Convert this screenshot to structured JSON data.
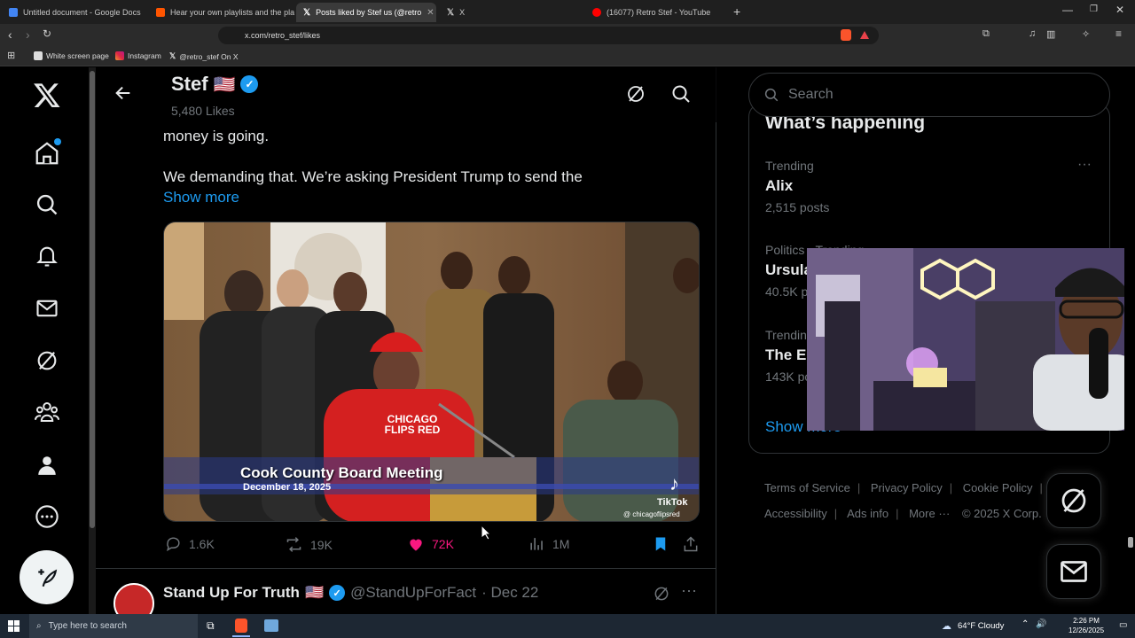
{
  "browser": {
    "tabs": [
      {
        "title": "Untitled document - Google Docs",
        "color": "#4285f4"
      },
      {
        "title": "Hear your own playlists and the play",
        "color": "#ff5500"
      },
      {
        "title": "Posts liked by Stef us (@retro",
        "color": "#ffffff",
        "active": true
      },
      {
        "title": "X",
        "color": "#ffffff"
      },
      {
        "title": "(16077) Retro Stef - YouTube",
        "color": "#ff0000"
      }
    ],
    "url": "x.com/retro_stef/likes",
    "bookmarks": [
      "White screen page",
      "Instagram",
      "@retro_stef On X"
    ]
  },
  "profile_header": {
    "name": "Stef",
    "flag": "🇺🇸",
    "likes_count": "5,480 Likes"
  },
  "tweet": {
    "text_line1": "money is going.",
    "text_line2": "We demanding that. We’re asking President Trump to send the",
    "show_more": "Show more",
    "video": {
      "banner_title": "Cook County Board Meeting",
      "banner_date": "December 18, 2025",
      "hoodie_text": "CHICAGO FLIPS RED",
      "watermark_app": "TikTok",
      "watermark_handle": "@ chicagoflipsred"
    },
    "actions": {
      "replies": "1.6K",
      "reposts": "19K",
      "likes": "72K",
      "views": "1M"
    }
  },
  "next_tweet": {
    "name": "Stand Up For Truth",
    "flag": "🇺🇸",
    "handle": "@StandUpForFact",
    "date": "· Dec 22"
  },
  "sidebar": {
    "search_placeholder": "Search",
    "section_title": "What’s happening",
    "trends": [
      {
        "category": "Trending",
        "name": "Alix",
        "count": "2,515 posts"
      },
      {
        "category": "Politics · Trending",
        "name": "Ursula",
        "count": "40.5K posts"
      },
      {
        "category": "Trending",
        "name": "The EU",
        "count": "143K posts"
      }
    ],
    "show_more": "Show more",
    "footer_links": [
      "Terms of Service",
      "Privacy Policy",
      "Cookie Policy",
      "Accessibility",
      "Ads info",
      "More ···"
    ],
    "copyright": "© 2025 X Corp."
  },
  "taskbar": {
    "search_placeholder": "Type here to search",
    "weather": "64°F  Cloudy",
    "time": "2:26 PM",
    "date": "12/26/2025"
  },
  "colors": {
    "accent": "#1d9bf0",
    "like": "#f91880",
    "bg": "#000000"
  }
}
